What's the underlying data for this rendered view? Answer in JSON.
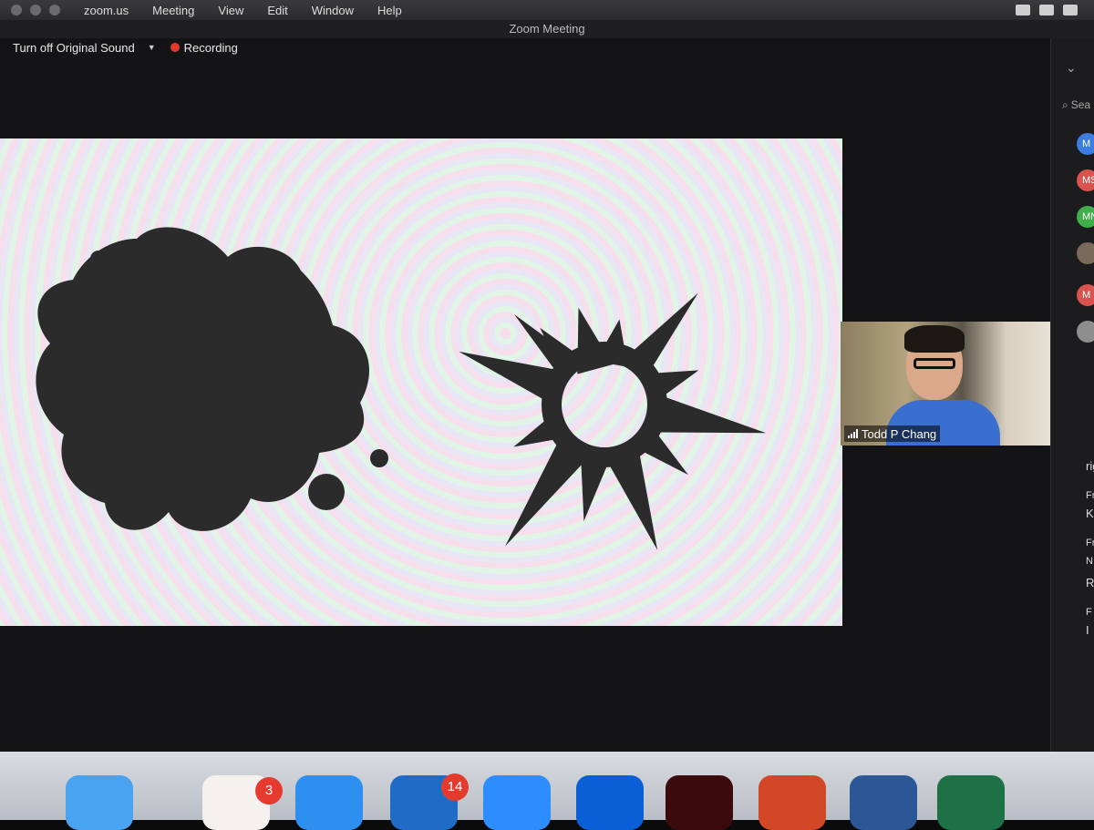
{
  "menu_bar": {
    "items": [
      "zoom.us",
      "Meeting",
      "View",
      "Edit",
      "Window",
      "Help"
    ]
  },
  "window": {
    "title": "Zoom Meeting"
  },
  "meeting_toolbar": {
    "original_sound_label": "Turn off Original Sound",
    "recording_label": "Recording"
  },
  "video_tile": {
    "participant_name": "Todd P Chang"
  },
  "participants_panel": {
    "search_label": "Sea",
    "avatars": [
      "M",
      "MS",
      "MN",
      "",
      "M",
      ""
    ],
    "text_fragments": [
      "rig",
      "Fr",
      "K",
      "Fr",
      "N",
      "R",
      "F",
      "I"
    ]
  },
  "dock": {
    "apps": [
      {
        "name": "Finder",
        "color": "#4aa3f0"
      },
      {
        "name": "Slack",
        "color": "#f4f1ef",
        "badge": "3"
      },
      {
        "name": "Safari",
        "color": "#2d8ff0"
      },
      {
        "name": "Outlook",
        "color": "#1f6bc6",
        "badge": "14"
      },
      {
        "name": "Zoom",
        "color": "#2d8cff"
      },
      {
        "name": "Dropbox",
        "color": "#0b5fd6"
      },
      {
        "name": "Acrobat",
        "color": "#3b0b0b"
      },
      {
        "name": "PowerPoint",
        "color": "#d24726"
      },
      {
        "name": "Word",
        "color": "#2b5797"
      },
      {
        "name": "Excel",
        "color": "#1e7145"
      }
    ]
  },
  "colors": {
    "recording": "#e5372b",
    "share_background": "#f3f0f0",
    "artwork": "#2b2b2b",
    "badge": "#e53b2f"
  }
}
